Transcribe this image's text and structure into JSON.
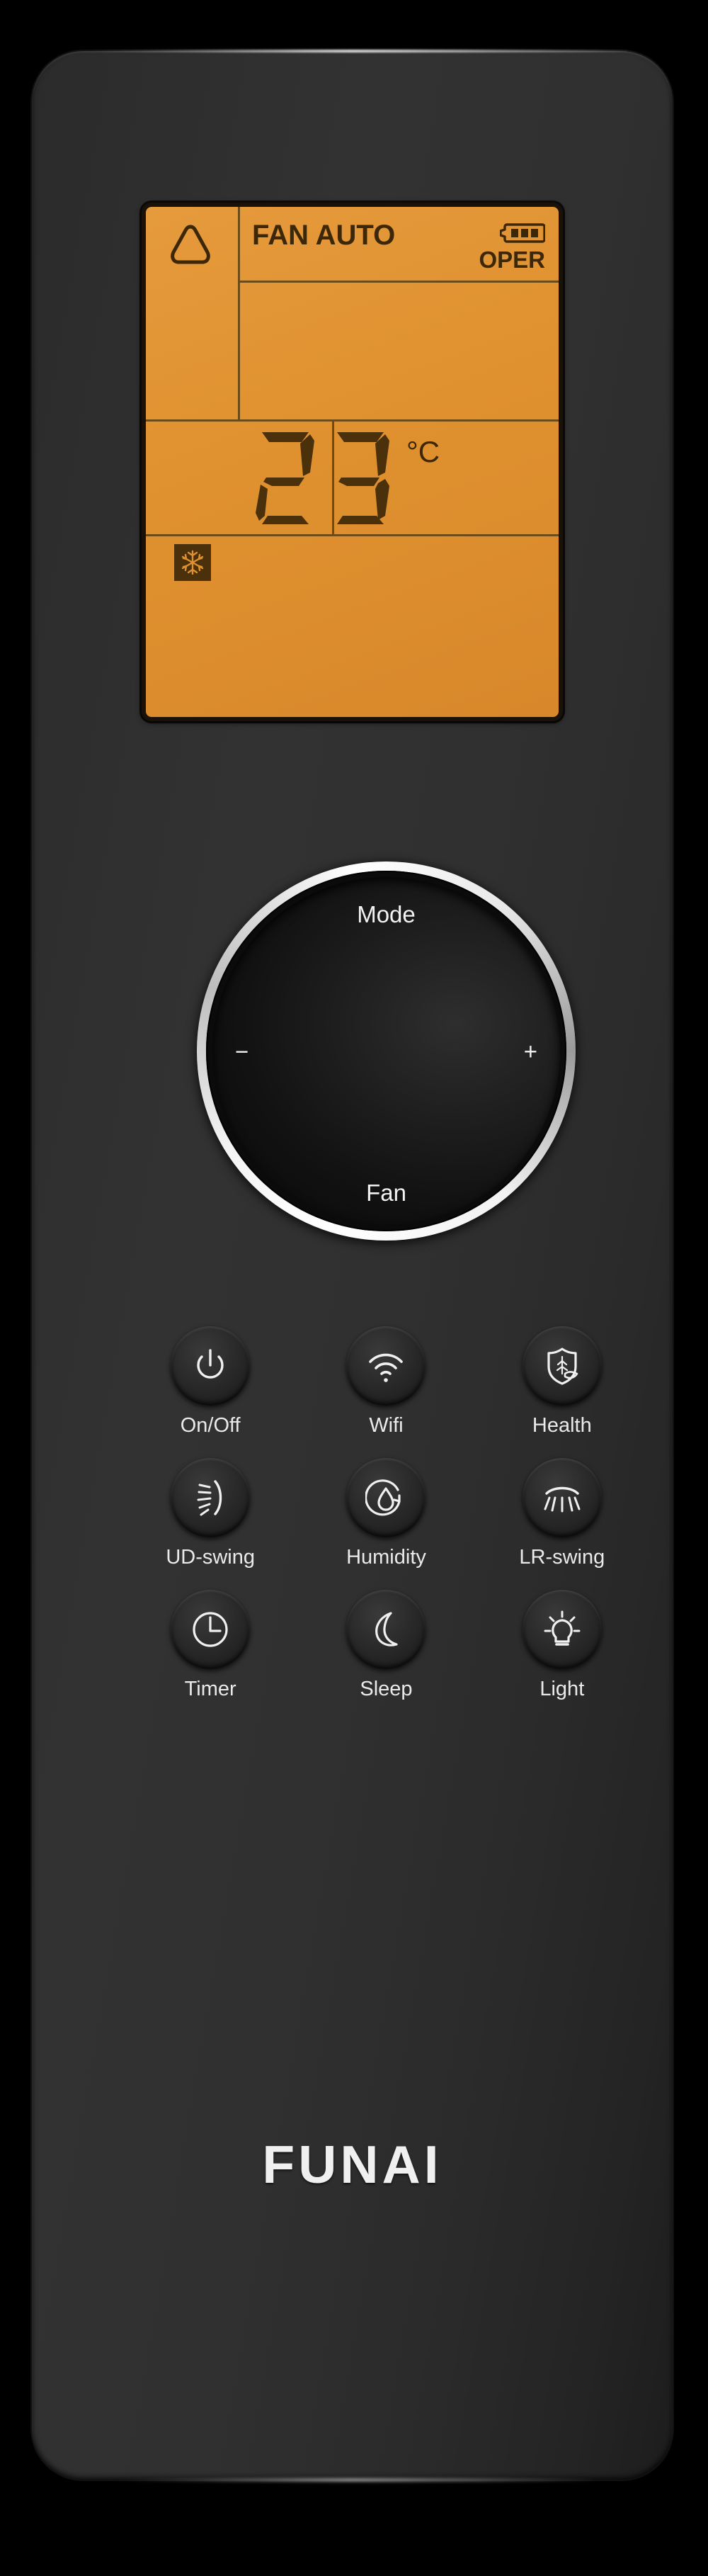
{
  "device": {
    "brand": "FUNAI",
    "type": "air-conditioner-remote"
  },
  "lcd": {
    "auto_icon": "rounded-triangle-icon",
    "fan_label": "FAN AUTO",
    "battery_icon": "battery-full-icon",
    "battery_bars": 3,
    "oper_label": "OPER",
    "temperature": "23",
    "temperature_digits": [
      "2",
      "3"
    ],
    "unit": "°C",
    "degree_symbol": "°",
    "unit_letter": "C",
    "mode_icon": "snowflake-icon",
    "mode": "cool",
    "background_color": "#e0912f",
    "segment_color": "#3c2708"
  },
  "dial": {
    "top_label": "Mode",
    "bottom_label": "Fan",
    "left_label": "−",
    "right_label": "+",
    "left_icon": "minus-icon",
    "right_icon": "plus-icon",
    "ring_color": "#ffffff"
  },
  "buttons": [
    {
      "label": "On/Off",
      "icon": "power-icon"
    },
    {
      "label": "Wifi",
      "icon": "wifi-icon"
    },
    {
      "label": "Health",
      "icon": "shield-health-icon"
    },
    {
      "label": "UD-swing",
      "icon": "up-down-swing-icon"
    },
    {
      "label": "Humidity",
      "icon": "humidity-droplet-icon"
    },
    {
      "label": "LR-swing",
      "icon": "left-right-swing-icon"
    },
    {
      "label": "Timer",
      "icon": "clock-icon"
    },
    {
      "label": "Sleep",
      "icon": "moon-icon"
    },
    {
      "label": "Light",
      "icon": "lightbulb-icon"
    }
  ],
  "colors": {
    "body": "#2e2e2e",
    "lcd_amber": "#e0912f",
    "lcd_dark": "#3c2708",
    "text": "#eaeaea"
  }
}
